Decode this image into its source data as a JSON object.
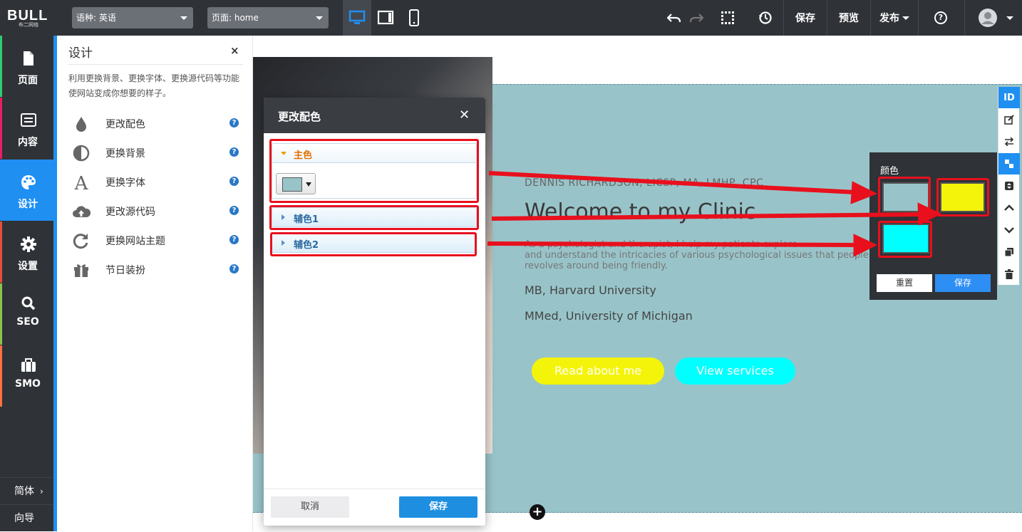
{
  "topbar": {
    "logo_text": "BULL",
    "logo_sub": "布二网络",
    "language_select": "语种: 英语",
    "page_select": "页面: home",
    "save_label": "保存",
    "preview_label": "预览",
    "publish_label": "发布",
    "help_label": "?"
  },
  "sidenav": {
    "items": [
      {
        "label": "页面",
        "icon": "page-icon",
        "accent": "#2ecc71"
      },
      {
        "label": "内容",
        "icon": "content-icon",
        "accent": "#e91e63"
      },
      {
        "label": "设计",
        "icon": "palette-icon",
        "accent": "#1f8ff2"
      },
      {
        "label": "设置",
        "icon": "gear-icon",
        "accent": "#e74c3c"
      },
      {
        "label": "SEO",
        "icon": "search-icon",
        "accent": "#8bc34a"
      },
      {
        "label": "SMO",
        "icon": "briefcase-icon",
        "accent": "#ff7043"
      }
    ],
    "bottom": [
      "简体",
      "向导"
    ]
  },
  "design_panel": {
    "title": "设计",
    "close": "×",
    "description": "利用更换背景、更换字体、更换源代码等功能使网站变成你想要的样子。",
    "items": [
      {
        "label": "更改配色",
        "icon": "drop-icon"
      },
      {
        "label": "更换背景",
        "icon": "contrast-icon"
      },
      {
        "label": "更换字体",
        "icon": "font-icon"
      },
      {
        "label": "更改源代码",
        "icon": "cloud-upload-icon"
      },
      {
        "label": "更换网站主题",
        "icon": "refresh-icon"
      },
      {
        "label": "节日装扮",
        "icon": "gift-icon"
      }
    ],
    "help_glyph": "?"
  },
  "hero": {
    "subtitle": "DENNIS RICHARDSON, LICSP, MA, LMHP, CPC",
    "title": "Welcome to my Clinic",
    "para_line1": "As a psychologist and therapist, I help my patients explore",
    "para_line2": "and understand the intricacies of various psychological issues that people",
    "para_line3": "revolves around being friendly.",
    "degree1": "MB, Harvard University",
    "degree2": "MMed, University of Michigan",
    "btn1": "Read about me",
    "btn2": "View services",
    "add_section": "+"
  },
  "right_tools": [
    "ID",
    "edit-icon",
    "swap-icon",
    "color-icon",
    "resize-icon",
    "chevron-up-icon",
    "chevron-down-icon",
    "copy-icon",
    "trash-icon"
  ],
  "color_popup": {
    "title": "颜色",
    "reset_label": "重置",
    "save_label": "保存"
  },
  "modal": {
    "title": "更改配色",
    "main_color_label": "主色",
    "accent1_label": "辅色1",
    "accent2_label": "辅色2",
    "cancel_label": "取消",
    "save_label": "保存"
  },
  "colors": {
    "primary": "#98c4c9",
    "accent1": "#f4f40a",
    "accent2": "#00ffff",
    "topbar": "#2f3237",
    "brand_blue": "#1f8ff2",
    "annotation_red": "#e8101d"
  }
}
